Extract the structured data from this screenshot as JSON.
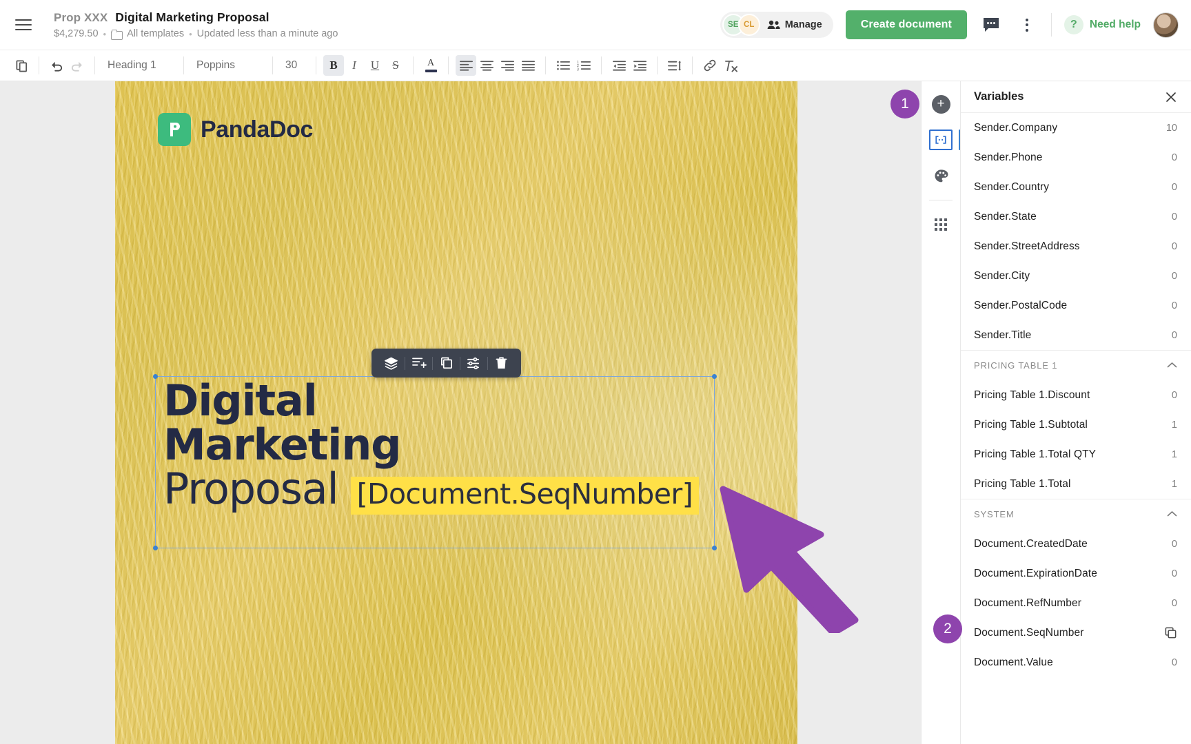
{
  "header": {
    "menu_icon": "hamburger-icon",
    "doc_code": "Prop XXX",
    "doc_title": "Digital Marketing Proposal",
    "amount": "$4,279.50",
    "sep": "•",
    "folder_icon": "folder-icon",
    "folder_label": "All templates",
    "updated": "Updated less than a minute ago",
    "avatars": [
      {
        "initials": "SE"
      },
      {
        "initials": "CL"
      }
    ],
    "manage_label": "Manage",
    "manage_icon": "people-icon",
    "create_button": "Create document",
    "comment_icon": "comment-icon",
    "more_icon": "kebab-menu-icon",
    "help_glyph": "?",
    "help_label": "Need help",
    "user_avatar": "user-avatar"
  },
  "toolbar": {
    "copy_icon": "duplicate-icon",
    "undo_icon": "undo-icon",
    "redo_icon": "redo-icon",
    "paragraph_style": "Heading 1",
    "font_family": "Poppins",
    "font_size": "30",
    "bold": "B",
    "italic": "I",
    "underline": "U",
    "strike": "S",
    "font_color": "A",
    "align_left": "align-left-icon",
    "align_center": "align-center-icon",
    "align_right": "align-right-icon",
    "align_justify": "align-justify-icon",
    "bullet_list": "bulleted-list-icon",
    "numbered_list": "numbered-list-icon",
    "outdent": "decrease-indent-icon",
    "indent": "increase-indent-icon",
    "line_spacing": "line-spacing-icon",
    "link": "link-icon",
    "clear_format": "clear-formatting-icon",
    "active_buttons": [
      "bold",
      "align_left"
    ]
  },
  "canvas": {
    "logo_text": "PandaDoc",
    "logo_mark": "pd",
    "floating_toolbar": [
      {
        "icon": "layers-icon",
        "name": "arrange-layers"
      },
      {
        "icon": "add-block-icon",
        "name": "add-block"
      },
      {
        "icon": "duplicate-icon",
        "name": "duplicate-block"
      },
      {
        "icon": "settings-sliders-icon",
        "name": "block-settings"
      },
      {
        "icon": "trash-icon",
        "name": "delete-block"
      }
    ],
    "headline_line1": "Digital",
    "headline_line2": "Marketing",
    "headline_line3": "Proposal",
    "variable_token": "[Document.SeqNumber]",
    "cursor": "arrow-cursor"
  },
  "rail": {
    "items": [
      {
        "icon": "plus-circle-icon",
        "name": "add-content",
        "selected": false
      },
      {
        "icon": "variable-brackets-icon",
        "name": "variables",
        "selected": true
      },
      {
        "icon": "palette-icon",
        "name": "theme",
        "selected": false
      },
      {
        "icon": "apps-grid-icon",
        "name": "apps",
        "selected": false
      }
    ]
  },
  "panel": {
    "title": "Variables",
    "close_icon": "close-icon",
    "top_variables": [
      {
        "name": "Sender.Company",
        "value": "10"
      },
      {
        "name": "Sender.Phone",
        "value": "0"
      },
      {
        "name": "Sender.Country",
        "value": "0"
      },
      {
        "name": "Sender.State",
        "value": "0"
      },
      {
        "name": "Sender.StreetAddress",
        "value": "0"
      },
      {
        "name": "Sender.City",
        "value": "0"
      },
      {
        "name": "Sender.PostalCode",
        "value": "0"
      },
      {
        "name": "Sender.Title",
        "value": "0"
      }
    ],
    "groups": [
      {
        "label": "PRICING TABLE 1",
        "chevron": "chevron-up-icon",
        "items": [
          {
            "name": "Pricing Table 1.Discount",
            "value": "0"
          },
          {
            "name": "Pricing Table 1.Subtotal",
            "value": "1"
          },
          {
            "name": "Pricing Table 1.Total QTY",
            "value": "1"
          },
          {
            "name": "Pricing Table 1.Total",
            "value": "1"
          }
        ]
      },
      {
        "label": "SYSTEM",
        "chevron": "chevron-up-icon",
        "items": [
          {
            "name": "Document.CreatedDate",
            "value": "0"
          },
          {
            "name": "Document.ExpirationDate",
            "value": "0"
          },
          {
            "name": "Document.RefNumber",
            "value": "0"
          },
          {
            "name": "Document.SeqNumber",
            "value": "",
            "copy_icon": "copy-icon"
          },
          {
            "name": "Document.Value",
            "value": "0"
          }
        ]
      }
    ]
  },
  "callouts": [
    {
      "number": "1"
    },
    {
      "number": "2"
    }
  ],
  "colors": {
    "accent_green": "#53b06b",
    "callout_purple": "#8e44ad",
    "page_yellow": "#e8c94c",
    "highlight_yellow": "#ffe047",
    "headline_navy": "#232a45"
  }
}
